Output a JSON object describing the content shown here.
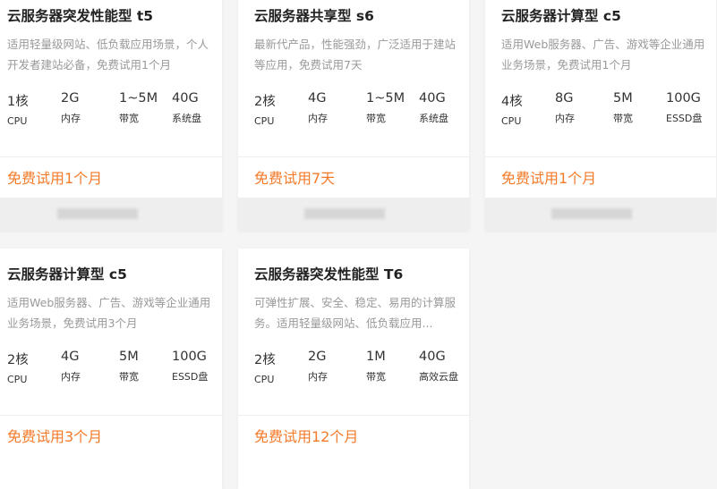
{
  "cards": [
    {
      "title": "云服务器突发性能型 t5",
      "desc": "适用轻量级网站、低负载应用场景，个人开发者建站必备，免费试用1个月",
      "specs": [
        {
          "v": "1核",
          "l": "CPU"
        },
        {
          "v": "2G",
          "l": "内存"
        },
        {
          "v": "1~5M",
          "l": "带宽"
        },
        {
          "v": "40G",
          "l": "系统盘"
        }
      ],
      "trial": "免费试用1个月"
    },
    {
      "title": "云服务器共享型 s6",
      "desc": "最新代产品，性能强劲，广泛适用于建站等应用，免费试用7天",
      "specs": [
        {
          "v": "2核",
          "l": "CPU"
        },
        {
          "v": "4G",
          "l": "内存"
        },
        {
          "v": "1~5M",
          "l": "带宽"
        },
        {
          "v": "40G",
          "l": "系统盘"
        }
      ],
      "trial": "免费试用7天"
    },
    {
      "title": "云服务器计算型 c5",
      "desc": "适用Web服务器、广告、游戏等企业通用业务场景，免费试用1个月",
      "specs": [
        {
          "v": "4核",
          "l": "CPU"
        },
        {
          "v": "8G",
          "l": "内存"
        },
        {
          "v": "5M",
          "l": "带宽"
        },
        {
          "v": "100G",
          "l": "ESSD盘"
        }
      ],
      "trial": "免费试用1个月"
    },
    {
      "title": "云服务器计算型 c5",
      "desc": "适用Web服务器、广告、游戏等企业通用业务场景，免费试用3个月",
      "specs": [
        {
          "v": "2核",
          "l": "CPU"
        },
        {
          "v": "4G",
          "l": "内存"
        },
        {
          "v": "5M",
          "l": "带宽"
        },
        {
          "v": "100G",
          "l": "ESSD盘"
        }
      ],
      "trial": "免费试用3个月"
    },
    {
      "title": "云服务器突发性能型 T6",
      "desc": "可弹性扩展、安全、稳定、易用的计算服务。适用轻量级网站、低负载应用...",
      "specs": [
        {
          "v": "2核",
          "l": "CPU"
        },
        {
          "v": "2G",
          "l": "内存"
        },
        {
          "v": "1M",
          "l": "带宽"
        },
        {
          "v": "40G",
          "l": "高效云盘"
        }
      ],
      "trial": "免费试用12个月"
    }
  ],
  "colors": {
    "accent": "#f47a28",
    "background": "#f5f5f5"
  }
}
